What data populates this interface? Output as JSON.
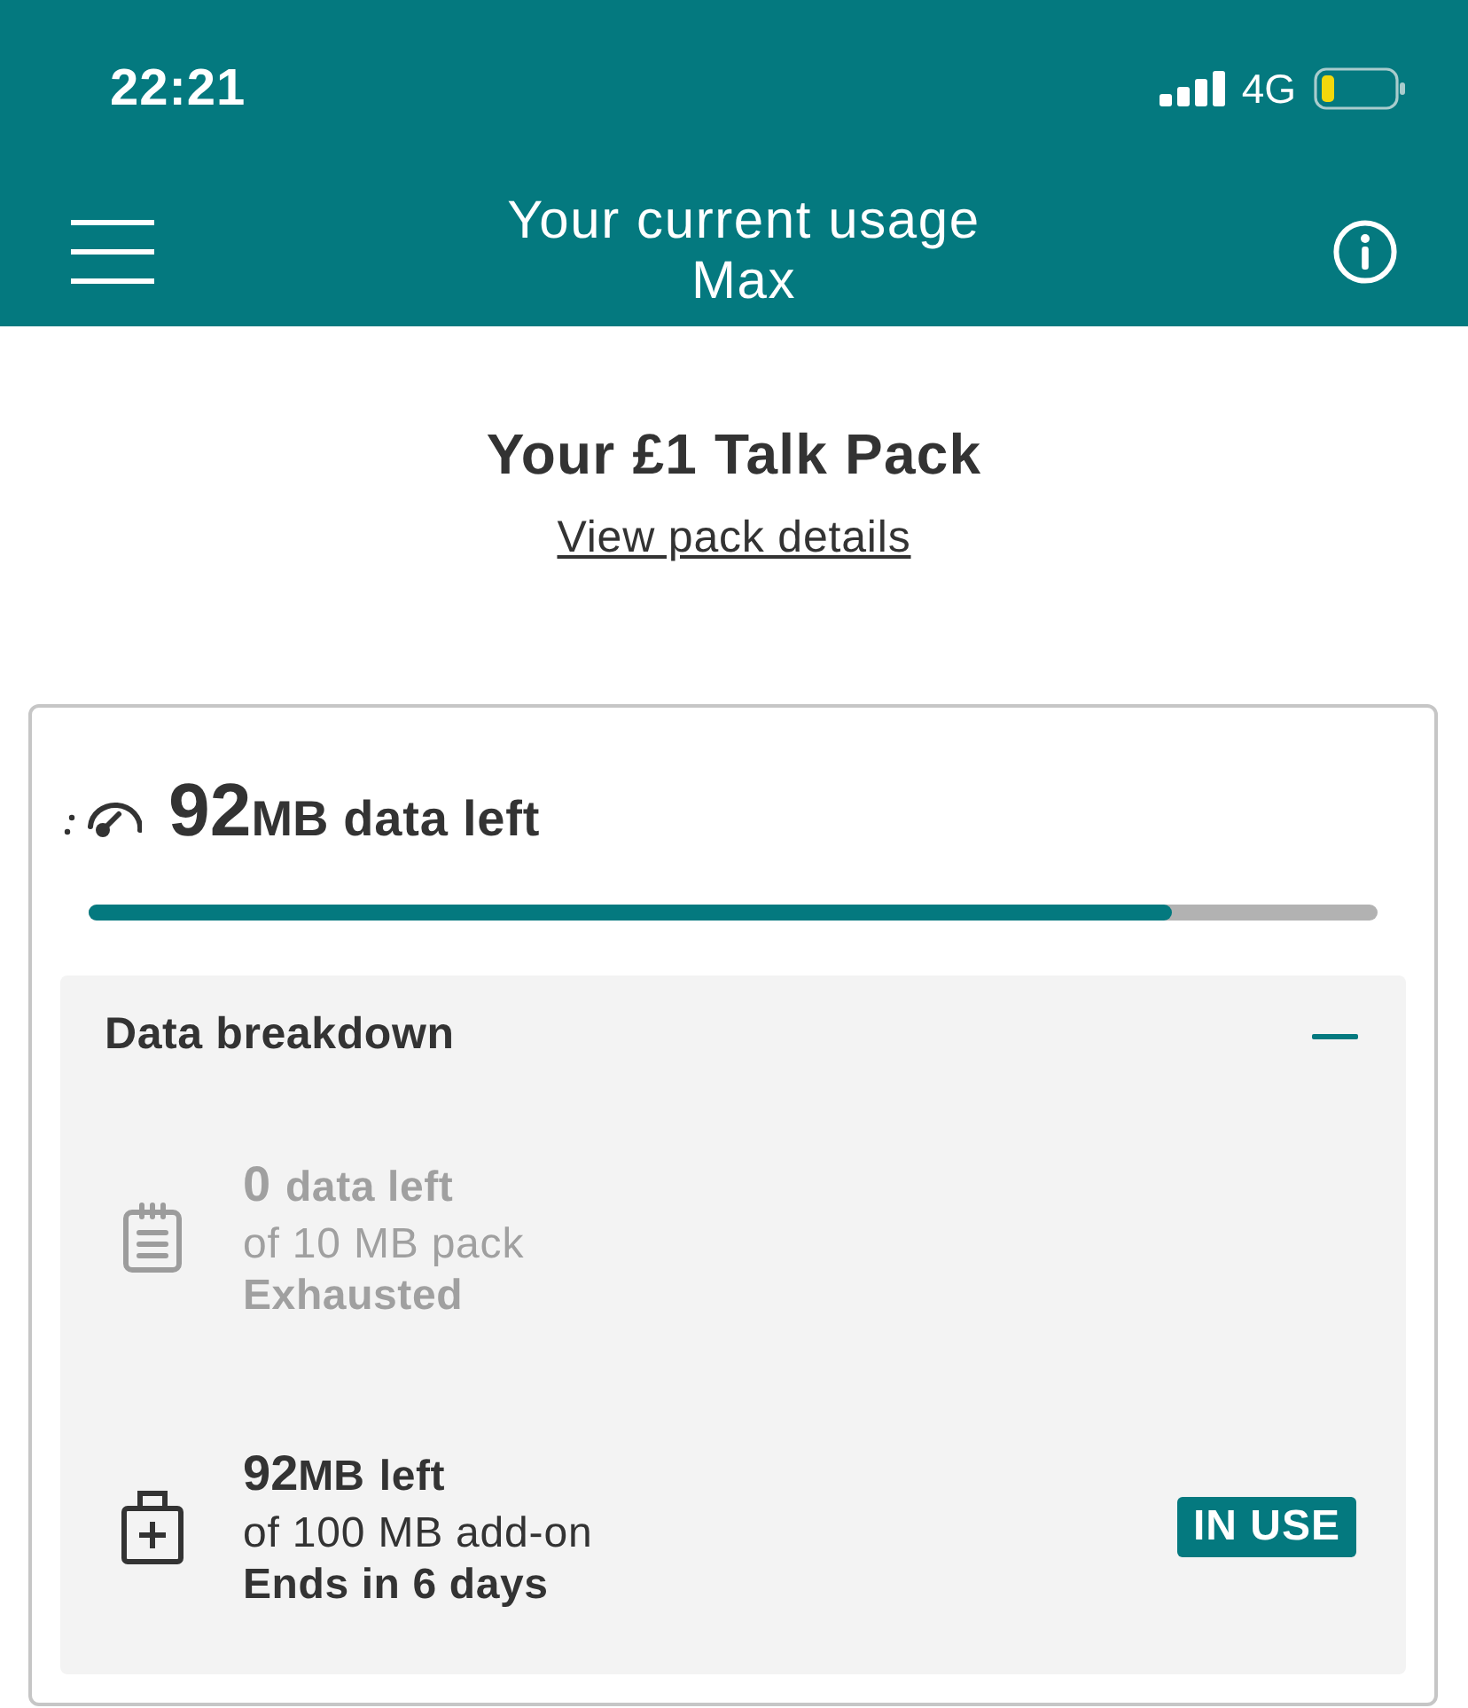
{
  "status_bar": {
    "time": "22:21",
    "network": "4G"
  },
  "header": {
    "title": "Your current usage",
    "subtitle": "Max"
  },
  "pack": {
    "title": "Your £1 Talk Pack",
    "link": "View pack details"
  },
  "summary": {
    "amount": "92",
    "unit": "MB",
    "label": "data left",
    "level": 0.84
  },
  "breakdown": {
    "title": "Data breakdown",
    "expanded": true,
    "items": [
      {
        "kind": "pack",
        "amount": "0",
        "label": "data left",
        "size": "of 10 MB pack",
        "status": "Exhausted",
        "disabled": true
      },
      {
        "kind": "addon",
        "amount": "92",
        "unit": "MB",
        "label": "left",
        "size": "of 100 MB add-on",
        "status": "Ends in 6 days",
        "disabled": false,
        "badge": "IN USE"
      }
    ]
  }
}
